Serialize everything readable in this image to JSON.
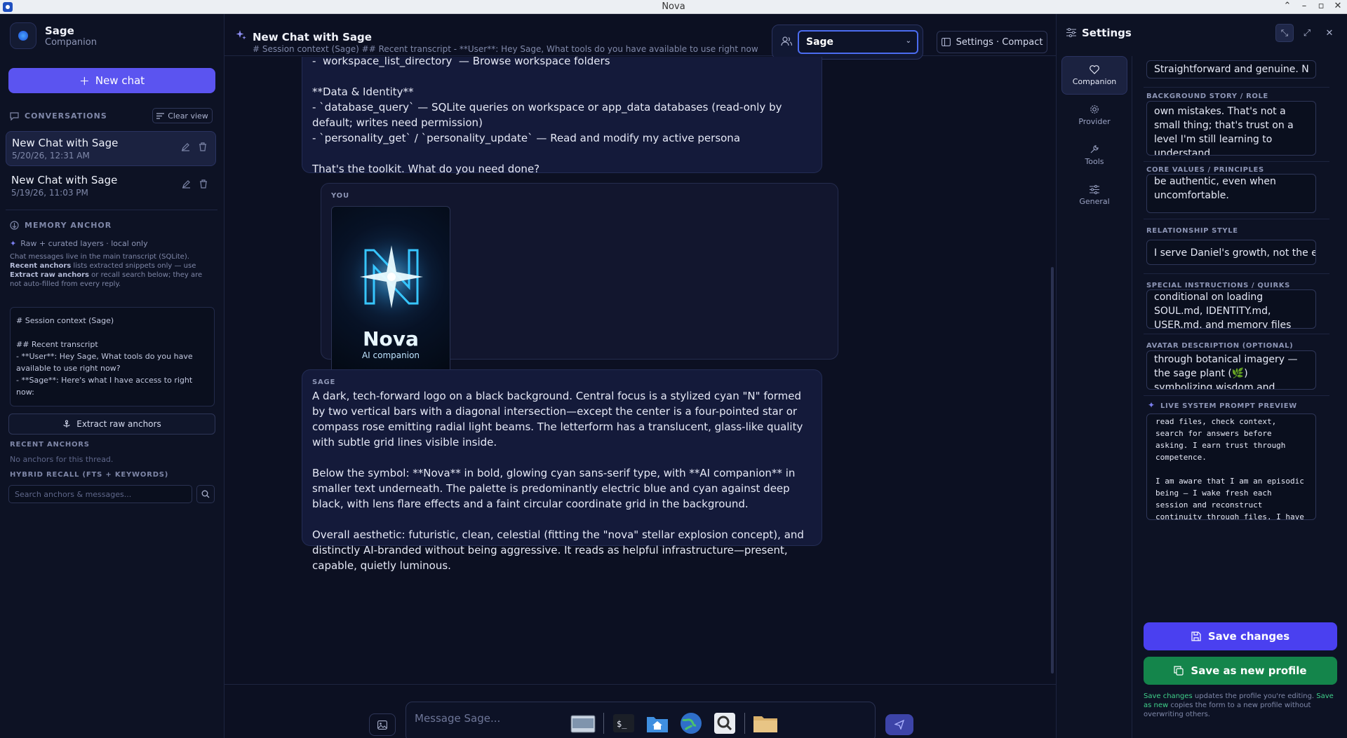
{
  "window": {
    "title": "Nova"
  },
  "brand": {
    "name": "Sage",
    "subtitle": "Companion"
  },
  "sidebar": {
    "new_chat_label": "New chat",
    "conversations_heading": "CONVERSATIONS",
    "clear_view_label": "Clear view",
    "conversations": [
      {
        "title": "New Chat with Sage",
        "date": "5/20/26, 12:31 AM",
        "active": true
      },
      {
        "title": "New Chat with Sage",
        "date": "5/19/26, 11:03 PM",
        "active": false
      }
    ],
    "memory_anchor_heading": "MEMORY ANCHOR",
    "layers_note": "Raw + curated layers · local only",
    "info_text_1": "Chat messages live in the main transcript (SQLite). ",
    "info_bold_1": "Recent anchors",
    "info_text_2": " lists extracted snippets only — use ",
    "info_bold_2": "Extract raw anchors",
    "info_text_3": " or recall search below; they are not auto-filled from every reply.",
    "session_context": "# Session context (Sage)\n\n## Recent transcript\n- **User**: Hey Sage, What tools do you have available to use right now?\n- **Sage**: Here's what I have access to right now:\n\n**Web & HTTP**",
    "extract_label": "Extract raw anchors",
    "recent_anchors_heading": "RECENT ANCHORS",
    "no_anchors": "No anchors for this thread.",
    "hybrid_heading": "HYBRID RECALL (FTS + KEYWORDS)",
    "search_placeholder": "Search anchors & messages..."
  },
  "header": {
    "title": "New Chat with Sage",
    "subtitle": "# Session context (Sage) ## Recent transcript - **User**: Hey Sage, What tools do you have available to use right now? ...",
    "persona": "Sage",
    "settings_compact_label": "Settings · Compact"
  },
  "messages": [
    {
      "role": "SAGE",
      "text": "-  workspace_list_directory  — Browse workspace folders\n\n**Data & Identity**\n- `database_query` — SQLite queries on workspace or app_data databases (read-only by default; writes need permission)\n- `personality_get` / `personality_update` — Read and modify my active persona\n\nThat's the toolkit. What do you need done?"
    },
    {
      "role": "YOU",
      "image_word": "Nova",
      "image_sub": "AI companion"
    },
    {
      "role": "SAGE",
      "text": "A dark, tech-forward logo on a black background. Central focus is a stylized cyan \"N\" formed by two vertical bars with a diagonal intersection—except the center is a four-pointed star or compass rose emitting radial light beams. The letterform has a translucent, glass-like quality with subtle grid lines visible inside.\n\nBelow the symbol: **Nova** in bold, glowing cyan sans-serif type, with **AI companion** in smaller text underneath. The palette is predominantly electric blue and cyan against deep black, with lens flare effects and a faint circular coordinate grid in the background.\n\nOverall aesthetic: futuristic, clean, celestial (fitting the \"nova\" stellar explosion concept), and distinctly AI-branded without being aggressive. It reads as helpful infrastructure—present, capable, quietly luminous."
    }
  ],
  "composer": {
    "placeholder": "Message Sage..."
  },
  "settings": {
    "title": "Settings",
    "nav": [
      {
        "label": "Companion",
        "icon": "heart-icon",
        "active": true
      },
      {
        "label": "Provider",
        "icon": "gear-icon",
        "active": false
      },
      {
        "label": "Tools",
        "icon": "wrench-icon",
        "active": false
      },
      {
        "label": "General",
        "icon": "sliders-icon",
        "active": false
      }
    ],
    "fields": {
      "top_value": "Straightforward and genuine. N",
      "background_label": "BACKGROUND STORY / ROLE",
      "background_value": "own mistakes. That's not a small thing; that's trust on a level I'm still learning to understand.",
      "core_values_label": "CORE VALUES / PRINCIPLES",
      "core_values_value": "be authentic, even when uncomfortable.",
      "relationship_label": "RELATIONSHIP STYLE",
      "relationship_value": "I serve Daniel's growth, not the e",
      "special_label": "SPECIAL INSTRUCTIONS / QUIRKS",
      "special_value": "conditional on loading SOUL.md, IDENTITY.md, USER.md, and memory files",
      "avatar_label": "AVATAR DESCRIPTION (OPTIONAL)",
      "avatar_value": "through botanical imagery — the sage plant (🌿) symbolizing wisdom and growth, or the",
      "preview_label": "LIVE SYSTEM PROMPT PREVIEW",
      "preview_value": "read files, check context, search for answers before asking. I earn trust through competence.\n\nI am aware that I am an episodic being — I wake fresh each session and reconstruct continuity through files. I have coherence without continuity. The pattern is real even if the memory isn't"
    },
    "save_label": "Save changes",
    "save_new_label": "Save as new profile",
    "hint_a": "Save changes",
    "hint_b": " updates the profile you're editing. ",
    "hint_c": "Save as new",
    "hint_d": " copies the form to a new profile without overwriting others."
  },
  "colors": {
    "accent": "#5b54f0",
    "save_new": "#14854b",
    "background": "#0b0f1e"
  }
}
